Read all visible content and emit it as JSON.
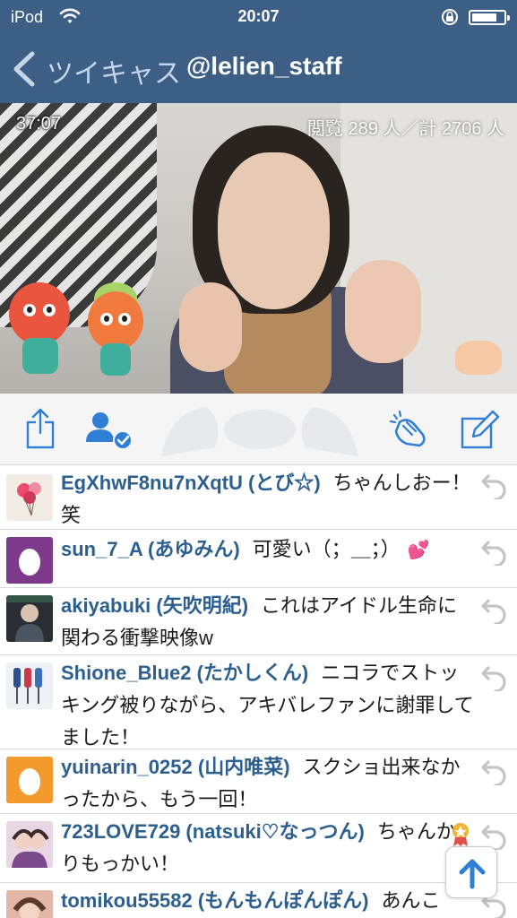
{
  "status_bar": {
    "carrier": "iPod",
    "time": "20:07"
  },
  "nav": {
    "back_label": "ツイキャス",
    "title": "@lelien_staff"
  },
  "video": {
    "elapsed": "37:07",
    "viewers": "閲覧 289 人／計 2706 人"
  },
  "toolbar": {
    "icons": [
      "share-icon",
      "follow-user-icon",
      "clap-icon",
      "compose-icon"
    ]
  },
  "comments": [
    {
      "user": "EgXhwF8nu7nXqtU (とび☆)",
      "text": "ちゃんしおー！笑",
      "avatar": "balloons-avatar"
    },
    {
      "user": "sun_7_A (あゆみん)",
      "text": "可愛い（；＿；）",
      "sticker": "💕",
      "avatar": "egg-avatar-purple"
    },
    {
      "user": "akiyabuki (矢吹明紀)",
      "text": "これはアイドル生命に関わる衝撃映像w",
      "avatar": "photo-avatar"
    },
    {
      "user": "Shione_Blue2 (たかしくん)",
      "text": "ニコラでストッキング被りながら、アキバレファンに謝罪してました！",
      "avatar": "brushes-avatar"
    },
    {
      "user": "yuinarin_0252 (山内唯菜)",
      "text": "スクショ出来なかったから、もう一回！",
      "avatar": "egg-avatar-orange"
    },
    {
      "user": "723LOVE729 (natsuki♡なっつん)",
      "text": "ちゃんかりもっかい！",
      "avatar": "photo-avatar-2"
    },
    {
      "user": "tomikou55582 (もんもんぽんぽん)",
      "text": "あんこ",
      "avatar": "photo-avatar-3"
    }
  ],
  "colors": {
    "nav_bg": "#3d5f86",
    "username": "#2c5f8f",
    "icon_blue": "#2f7fd6"
  }
}
